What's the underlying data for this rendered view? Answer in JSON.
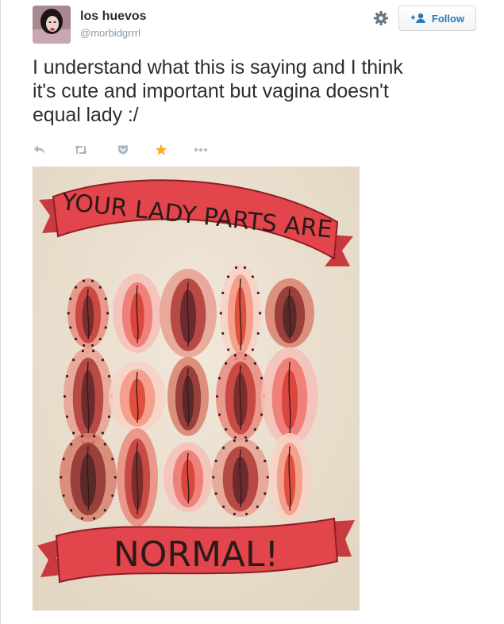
{
  "user": {
    "name": "los huevos",
    "handle": "@morbidgrrrl"
  },
  "follow_button": {
    "label": "Follow"
  },
  "tweet": {
    "text_line1": "I understand what this is saying and I think",
    "text_line2": "it's cute and important but vagina doesn't",
    "text_line3": "equal lady :/"
  },
  "actions": {
    "icons": [
      "reply-icon",
      "retweet-icon",
      "pocket-icon",
      "favorite-star-icon",
      "more-icon"
    ],
    "favorited": true
  },
  "media": {
    "banner_top": "YOUR LADY PARTS ARE",
    "banner_bottom": "NORMAL!"
  },
  "colors": {
    "link": "#2b7bb9",
    "star": "#ffac33",
    "banner": "#e2454b",
    "paper": "#ece1d2"
  }
}
